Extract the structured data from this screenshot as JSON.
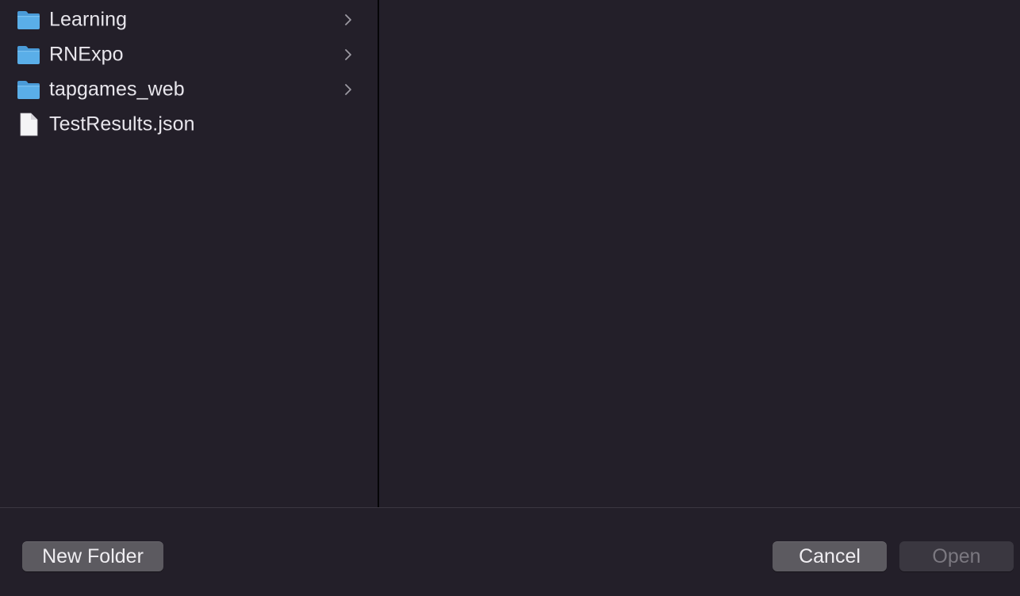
{
  "browser": {
    "items": [
      {
        "label": "Learning",
        "kind": "folder",
        "icon": "folder-icon",
        "has_children": true
      },
      {
        "label": "RNExpo",
        "kind": "folder",
        "icon": "folder-icon",
        "has_children": true
      },
      {
        "label": "tapgames_web",
        "kind": "folder",
        "icon": "folder-icon",
        "has_children": true
      },
      {
        "label": "TestResults.json",
        "kind": "file",
        "icon": "document-icon",
        "has_children": false
      }
    ]
  },
  "footer": {
    "new_folder_label": "New Folder",
    "cancel_label": "Cancel",
    "open_label": "Open",
    "open_enabled": false
  },
  "colors": {
    "background": "#231f29",
    "folder_blue": "#5aaee8",
    "button_bg": "#5c5a60",
    "button_disabled_bg": "#3a3740"
  }
}
